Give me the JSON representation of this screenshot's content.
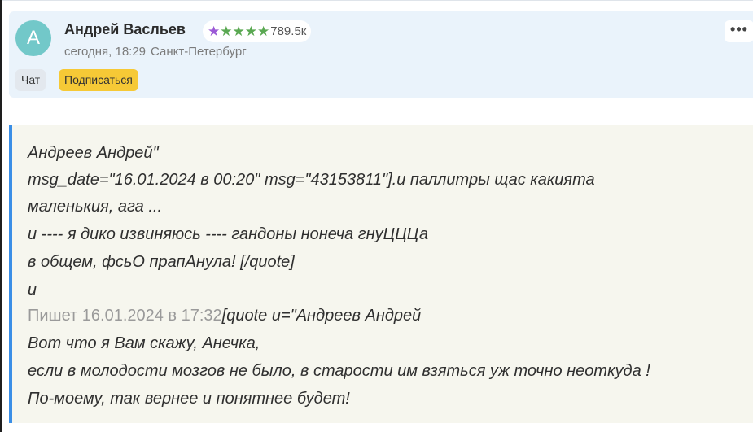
{
  "post": {
    "avatar_letter": "А",
    "author": "Андрей Васльев",
    "rating": {
      "stars": 5,
      "count": "789.5к",
      "star_colors": [
        "#9b59d6",
        "#5aa852",
        "#5aa852",
        "#5aa852",
        "#5aa852"
      ]
    },
    "date": "сегодня, 18:29",
    "city": "Санкт-Петербург",
    "chat_label": "Чат",
    "subscribe_label": "Подписаться",
    "more_label": "•••"
  },
  "quote": {
    "lines": [
      "Андреев Андрей\"",
      "msg_date=\"16.01.2024 в 00:20\" msg=\"43153811\"].и паллитры щас какията",
      "маленькия, ага ...",
      "и ---- я дико извиняюсь ---- гандоны нонеча гнуЦЦЦа",
      "в общем, фсьО прапАнула! [/quote]",
      "и"
    ],
    "written_prefix": "Пишет 16.01.2024 в 17:32",
    "written_suffix": "[quote u=\"Андреев Андрей",
    "lines2": [
      "Вот что я Вам скажу, Анечка,",
      "если в молодости мозгов не было, в старости им взяться уж точно неоткуда !",
      "По-моему, так вернее и понятнее будет!"
    ]
  },
  "colors": {
    "accent_bar": "#3a8ee6",
    "subscribe_bg": "#f6c936",
    "avatar_bg": "#72c8c9"
  }
}
